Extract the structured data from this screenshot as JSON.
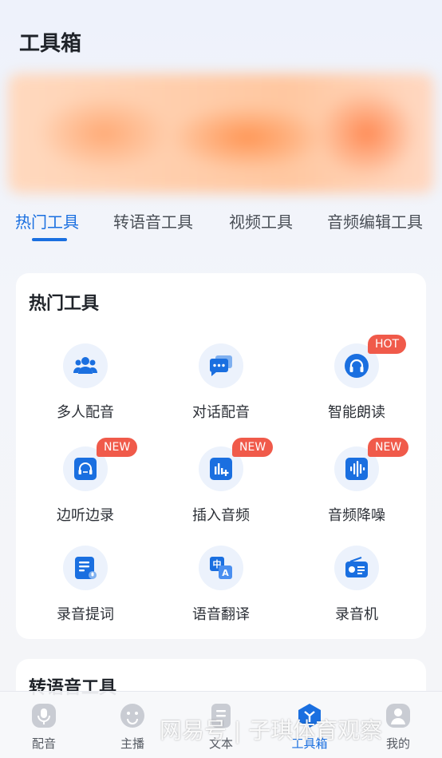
{
  "page": {
    "title": "工具箱"
  },
  "tabs": [
    {
      "label": "热门工具",
      "active": true
    },
    {
      "label": "转语音工具",
      "active": false
    },
    {
      "label": "视频工具",
      "active": false
    },
    {
      "label": "音频编辑工具",
      "active": false
    }
  ],
  "hot_tools": {
    "title": "热门工具",
    "items": [
      {
        "label": "多人配音",
        "icon": "multi-person-icon",
        "badge": ""
      },
      {
        "label": "对话配音",
        "icon": "chat-bubble-icon",
        "badge": ""
      },
      {
        "label": "智能朗读",
        "icon": "headphones-icon",
        "badge": "HOT"
      },
      {
        "label": "边听边录",
        "icon": "listen-record-icon",
        "badge": "NEW"
      },
      {
        "label": "插入音频",
        "icon": "insert-audio-icon",
        "badge": "NEW"
      },
      {
        "label": "音频降噪",
        "icon": "waveform-icon",
        "badge": "NEW"
      },
      {
        "label": "录音提词",
        "icon": "teleprompter-icon",
        "badge": ""
      },
      {
        "label": "语音翻译",
        "icon": "translate-icon",
        "badge": ""
      },
      {
        "label": "录音机",
        "icon": "recorder-icon",
        "badge": ""
      }
    ]
  },
  "tts_tools": {
    "title": "转语音工具"
  },
  "bottom_nav": [
    {
      "label": "配音",
      "icon": "mic-icon"
    },
    {
      "label": "主播",
      "icon": "face-icon"
    },
    {
      "label": "文本",
      "icon": "document-icon"
    },
    {
      "label": "工具箱",
      "icon": "toolbox-icon",
      "active": true
    },
    {
      "label": "我的",
      "icon": "profile-icon"
    }
  ],
  "watermark": "网易号 | 子琪体育观察",
  "colors": {
    "accent": "#1a6fe0",
    "badge": "#f05a4a",
    "icon_bg": "#ecf2fc"
  }
}
